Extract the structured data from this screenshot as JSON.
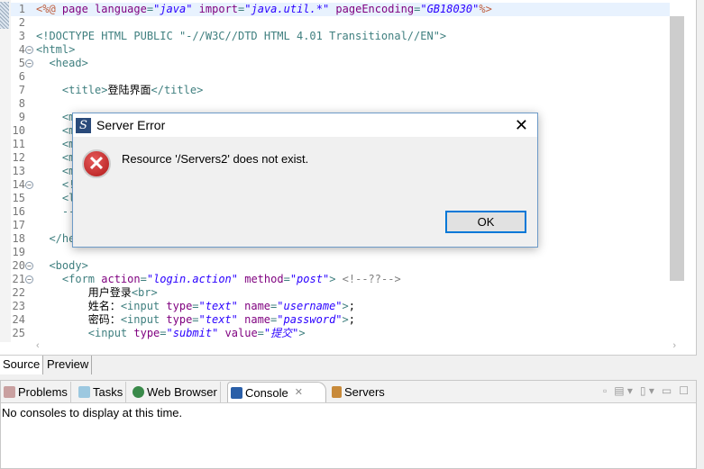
{
  "editor": {
    "lines": [
      {
        "n": "1",
        "html": "<span class='k'>&lt;%@</span> <span class='a'>page language</span>=<span class='v'>\"java\"</span> <span class='a'>import</span>=<span class='v'>\"java.util.*\"</span> <span class='a'>pageEncoding</span>=<span class='v'>\"GB18030\"</span><span class='k'>%&gt;</span>"
      },
      {
        "n": "2",
        "html": ""
      },
      {
        "n": "3",
        "html": "&lt;!DOCTYPE HTML PUBLIC \"-//W3C//DTD HTML 4.01 Transitional//EN\"&gt;"
      },
      {
        "n": "4",
        "fold": true,
        "html": "&lt;html&gt;"
      },
      {
        "n": "5",
        "fold": true,
        "html": "  &lt;head&gt;"
      },
      {
        "n": "6",
        "html": ""
      },
      {
        "n": "7",
        "html": "    &lt;title&gt;<span class='p'>登陆界面</span>&lt;/title&gt;"
      },
      {
        "n": "8",
        "html": ""
      },
      {
        "n": "9",
        "html": "    &lt;m"
      },
      {
        "n": "10",
        "html": "    &lt;m"
      },
      {
        "n": "11",
        "html": "    &lt;m"
      },
      {
        "n": "12",
        "html": "    &lt;m"
      },
      {
        "n": "13",
        "html": "    &lt;m"
      },
      {
        "n": "14",
        "fold": true,
        "html": "    &lt;!"
      },
      {
        "n": "15",
        "html": "    &lt;l"
      },
      {
        "n": "16",
        "html": "    --"
      },
      {
        "n": "17",
        "html": ""
      },
      {
        "n": "18",
        "html": "  &lt;/he"
      },
      {
        "n": "19",
        "html": ""
      },
      {
        "n": "20",
        "fold": true,
        "html": "  &lt;body&gt;"
      },
      {
        "n": "21",
        "fold": true,
        "html": "    &lt;form <span class='a'>action</span>=<span class='v'>\"login.action\"</span> <span class='a'>method</span>=<span class='v'>\"post\"</span>&gt; <span class='d'>&lt;!--??--&gt;</span>"
      },
      {
        "n": "22",
        "html": "        <span class='p'>用户登录</span>&lt;br&gt;"
      },
      {
        "n": "23",
        "html": "        <span class='p'>姓名：</span>&lt;input <span class='a'>type</span>=<span class='v'>\"text\"</span> <span class='a'>name</span>=<span class='v'>\"username\"</span>&gt;<span class='p'>;</span>"
      },
      {
        "n": "24",
        "html": "        <span class='p'>密码：</span>&lt;input <span class='a'>type</span>=<span class='v'>\"text\"</span> <span class='a'>name</span>=<span class='v'>\"password\"</span>&gt;<span class='p'>;</span>"
      },
      {
        "n": "25",
        "html": "        &lt;input <span class='a'>type</span>=<span class='v'>\"submit\"</span> <span class='a'>value</span>=<span class='v'>\"提交\"</span>&gt;"
      }
    ]
  },
  "editor_tabs": [
    "Source",
    "Preview"
  ],
  "panel": {
    "tabs": [
      "Problems",
      "Tasks",
      "Web Browser",
      "Console",
      "Servers"
    ],
    "active": "Console",
    "message": "No consoles to display at this time."
  },
  "dialog": {
    "title": "Server Error",
    "message": "Resource '/Servers2' does not exist.",
    "ok": "OK",
    "logo": "S"
  }
}
